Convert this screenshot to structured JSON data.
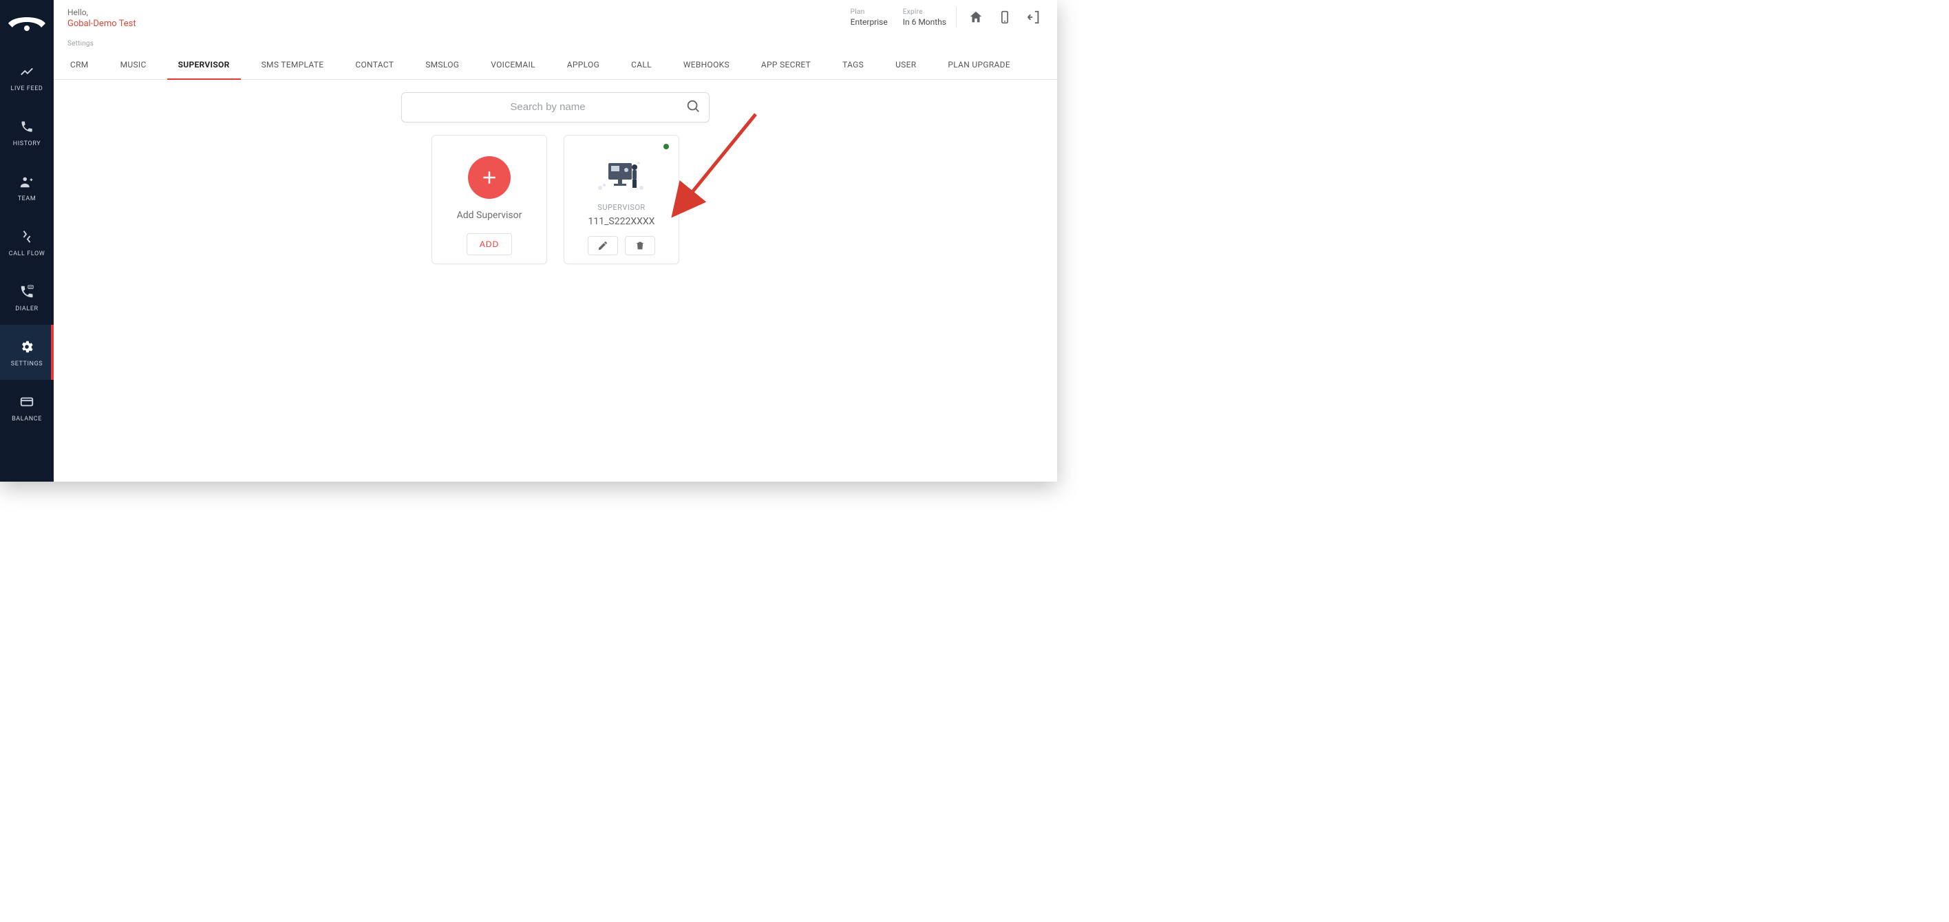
{
  "header": {
    "hello": "Hello,",
    "user_name": "Gobal-Demo Test",
    "plan_label": "Plan",
    "plan_value": "Enterprise",
    "expire_label": "Expire",
    "expire_value": "In 6 Months"
  },
  "breadcrumb": "Settings",
  "sidebar": {
    "items": [
      {
        "key": "live-feed",
        "label": "LIVE FEED"
      },
      {
        "key": "history",
        "label": "HISTORY"
      },
      {
        "key": "team",
        "label": "TEAM"
      },
      {
        "key": "call-flow",
        "label": "CALL FLOW"
      },
      {
        "key": "dialer",
        "label": "DIALER"
      },
      {
        "key": "settings",
        "label": "SETTINGS"
      },
      {
        "key": "balance",
        "label": "BALANCE"
      }
    ]
  },
  "tabs": [
    "CRM",
    "MUSIC",
    "SUPERVISOR",
    "SMS TEMPLATE",
    "CONTACT",
    "SMSLOG",
    "VOICEMAIL",
    "APPLOG",
    "CALL",
    "WEBHOOKS",
    "APP SECRET",
    "TAGS",
    "USER",
    "PLAN UPGRADE"
  ],
  "tabs_selected_index": 2,
  "search": {
    "placeholder": "Search by name",
    "value": ""
  },
  "add_card": {
    "caption": "Add Supervisor",
    "button": "ADD"
  },
  "supervisor_card": {
    "role": "SUPERVISOR",
    "name": "111_S222XXXX",
    "status": "online"
  }
}
